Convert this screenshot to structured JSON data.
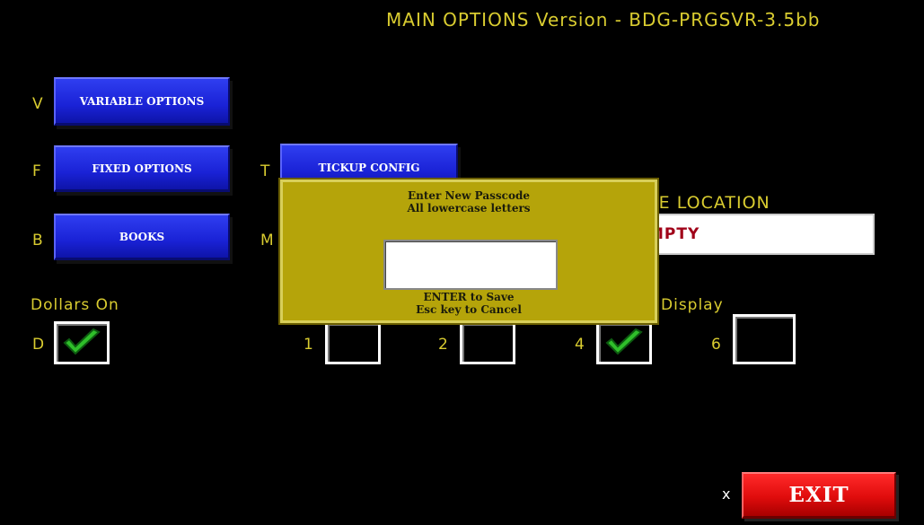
{
  "header": {
    "title": "MAIN OPTIONS  Version - BDG-PRGSVR-3.5bb"
  },
  "menu": {
    "variable": {
      "hotkey": "V",
      "label": "VARIABLE OPTIONS"
    },
    "fixed": {
      "hotkey": "F",
      "label": "FIXED OPTIONS"
    },
    "books": {
      "hotkey": "B",
      "label": "BOOKS"
    },
    "tickup": {
      "hotkey": "T",
      "label": "TICKUP CONFIG"
    },
    "m_hotkey": "M"
  },
  "passive": {
    "label": "SIVE LOCATION",
    "value": "MPTY"
  },
  "dollars": {
    "label": "Dollars On",
    "hotkey": "D",
    "checked": true
  },
  "display": {
    "label": "Display",
    "options": [
      {
        "num": "1",
        "checked": false
      },
      {
        "num": "2",
        "checked": false
      },
      {
        "num": "4",
        "checked": true
      },
      {
        "num": "6",
        "checked": false
      }
    ]
  },
  "dialog": {
    "line1": "Enter New Passcode",
    "line2": "All lowercase letters",
    "input_value": "",
    "footer1": "ENTER to Save",
    "footer2": "Esc key to Cancel"
  },
  "exit": {
    "hotkey": "X",
    "label": "EXIT"
  },
  "colors": {
    "accent_yellow": "#d9cc30",
    "button_blue": "#1a22d6",
    "exit_red": "#e00c0c",
    "dialog_olive": "#b5a40a",
    "check_green": "#2fbf2a"
  }
}
